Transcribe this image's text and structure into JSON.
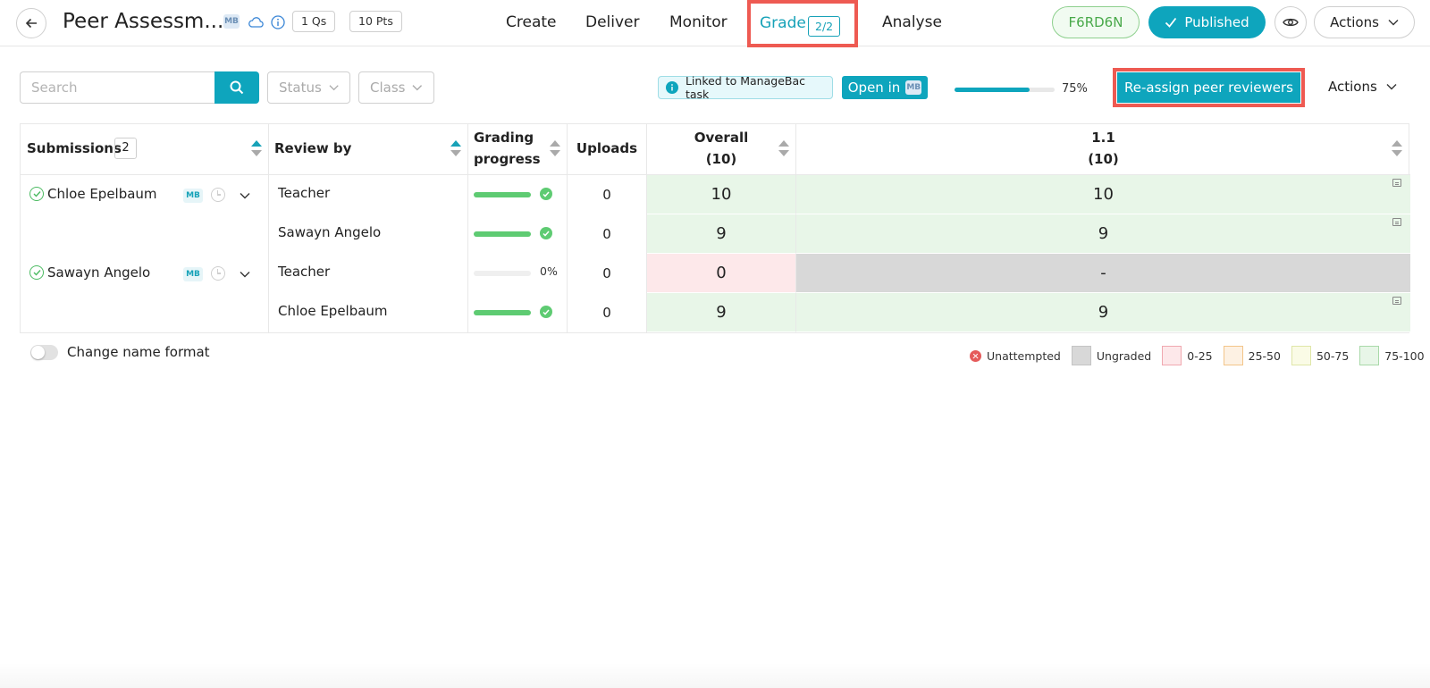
{
  "header": {
    "title": "Peer Assessm...",
    "mb_badge": "MB",
    "questions": "1 Qs",
    "points": "10 Pts",
    "tabs": {
      "create": "Create",
      "deliver": "Deliver",
      "monitor": "Monitor",
      "grade": "Grade",
      "grade_count": "2/2",
      "analyse": "Analyse"
    },
    "code": "F6RD6N",
    "published": "Published",
    "actions": "Actions"
  },
  "toolbar": {
    "search_placeholder": "Search",
    "status": "Status",
    "class": "Class",
    "linked_label": "Linked to ManageBac task",
    "open_in": "Open in",
    "open_in_badge": "MB",
    "progress": 0.75,
    "progress_text": "75%",
    "reassign": "Re-assign peer reviewers",
    "actions": "Actions"
  },
  "table": {
    "headers": {
      "submissions": "Submissions",
      "submissions_count": "2",
      "review_by": "Review by",
      "grading_line1": "Grading",
      "grading_line2": "progress",
      "uploads": "Uploads",
      "overall_line1": "Overall",
      "overall_line2": "(10)",
      "q_line1": "1.1",
      "q_line2": "(10)"
    },
    "mb_tag": "MB",
    "students": [
      {
        "name": "Chloe Epelbaum",
        "reviews": [
          {
            "reviewer": "Teacher",
            "progress": 1.0,
            "progress_text": "",
            "uploads": "0",
            "overall": "10",
            "q": "10",
            "status": "75-100"
          },
          {
            "reviewer": "Sawayn Angelo",
            "progress": 1.0,
            "progress_text": "",
            "uploads": "0",
            "overall": "9",
            "q": "9",
            "status": "75-100"
          }
        ]
      },
      {
        "name": "Sawayn Angelo",
        "reviews": [
          {
            "reviewer": "Teacher",
            "progress": 0.0,
            "progress_text": "0%",
            "uploads": "0",
            "overall": "0",
            "q": "-",
            "status": "0-25"
          },
          {
            "reviewer": "Chloe Epelbaum",
            "progress": 1.0,
            "progress_text": "",
            "uploads": "0",
            "overall": "9",
            "q": "9",
            "status": "75-100"
          }
        ]
      }
    ]
  },
  "footer": {
    "toggle_label": "Change name format",
    "legend": {
      "unattempted": "Unattempted",
      "ungraded": "Ungraded",
      "r0_25": "0-25",
      "r25_50": "25-50",
      "r50_75": "50-75",
      "r75_100": "75-100"
    }
  },
  "colors": {
    "accent": "#0ea5bd",
    "highlight": "#ee5a52",
    "green_fill": "#e8f6e8",
    "red_fill": "#fde8ea",
    "ungraded_fill": "#d8d8d8"
  }
}
